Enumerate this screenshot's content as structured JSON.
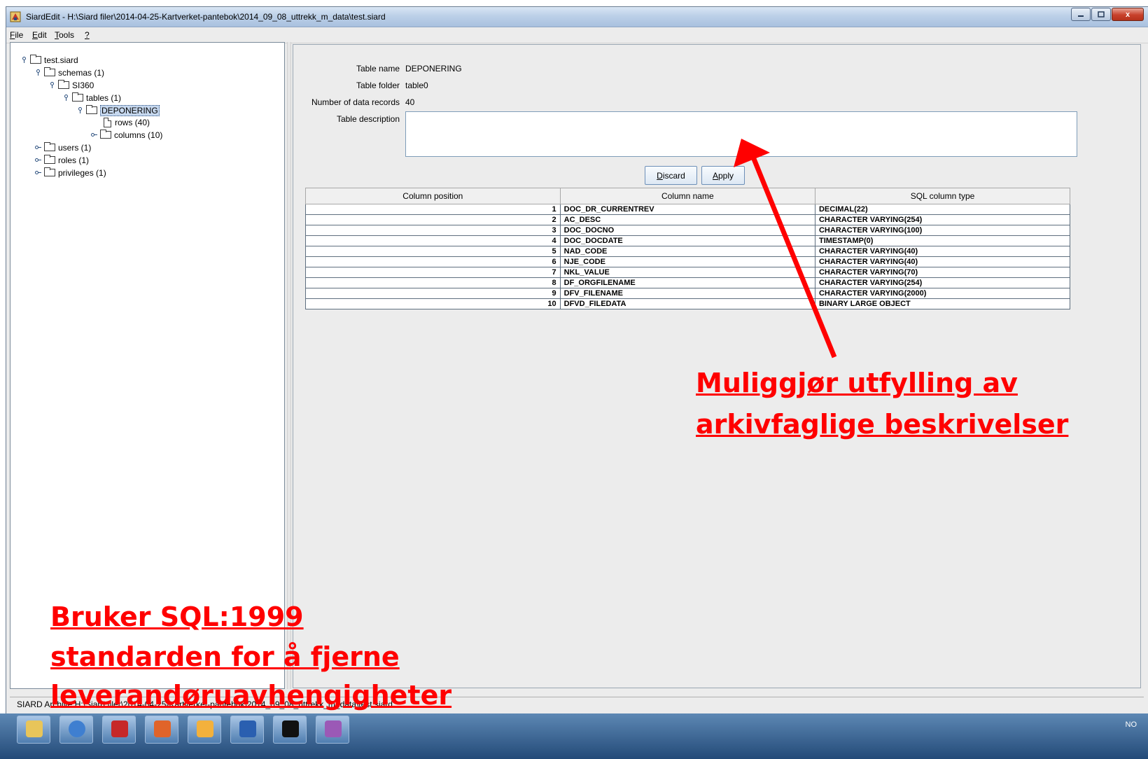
{
  "window": {
    "title": "SiardEdit - H:\\Siard filer\\2014-04-25-Kartverket-pantebok\\2014_09_08_uttrekk_m_data\\test.siard",
    "controls": {
      "minimize": "–",
      "maximize": "□",
      "close": "x"
    }
  },
  "menu": [
    {
      "label": "File",
      "mnemonic": "F",
      "rest": "ile"
    },
    {
      "label": "Edit",
      "mnemonic": "E",
      "rest": "dit"
    },
    {
      "label": "Tools",
      "mnemonic": "T",
      "rest": "ools"
    },
    {
      "label": "?",
      "mnemonic": "?",
      "rest": ""
    }
  ],
  "tree": [
    {
      "label": "test.siard",
      "icon": "folder-icon",
      "expanded": true
    },
    {
      "label": "schemas (1)",
      "icon": "folder-icon",
      "expanded": true
    },
    {
      "label": "SI360",
      "icon": "folder-icon",
      "expanded": true
    },
    {
      "label": "tables (1)",
      "icon": "folder-icon",
      "expanded": true
    },
    {
      "label": "DEPONERING",
      "icon": "folder-icon",
      "expanded": true,
      "selected": true
    },
    {
      "label": "rows (40)",
      "icon": "file-icon",
      "leaf": true
    },
    {
      "label": "columns (10)",
      "icon": "folder-icon",
      "expanded": false
    },
    {
      "label": "users (1)",
      "icon": "folder-icon",
      "expanded": false
    },
    {
      "label": "roles (1)",
      "icon": "folder-icon",
      "expanded": false
    },
    {
      "label": "privileges (1)",
      "icon": "folder-icon",
      "expanded": false
    }
  ],
  "properties": {
    "table_name_label": "Table name",
    "table_name_value": "DEPONERING",
    "table_folder_label": "Table folder",
    "table_folder_value": "table0",
    "records_label": "Number of data records",
    "records_value": "40",
    "description_label": "Table description",
    "description_value": ""
  },
  "buttons": {
    "discard": {
      "label": "Discard",
      "mnemonic": "D",
      "rest": "iscard"
    },
    "apply": {
      "label": "Apply",
      "mnemonic": "A",
      "rest": "pply"
    }
  },
  "grid": {
    "headers": [
      "Column position",
      "Column name",
      "SQL column type"
    ],
    "rows": [
      [
        "1",
        "DOC_DR_CURRENTREV",
        "DECIMAL(22)"
      ],
      [
        "2",
        "AC_DESC",
        "CHARACTER VARYING(254)"
      ],
      [
        "3",
        "DOC_DOCNO",
        "CHARACTER VARYING(100)"
      ],
      [
        "4",
        "DOC_DOCDATE",
        "TIMESTAMP(0)"
      ],
      [
        "5",
        "NAD_CODE",
        "CHARACTER VARYING(40)"
      ],
      [
        "6",
        "NJE_CODE",
        "CHARACTER VARYING(40)"
      ],
      [
        "7",
        "NKL_VALUE",
        "CHARACTER VARYING(70)"
      ],
      [
        "8",
        "DF_ORGFILENAME",
        "CHARACTER VARYING(254)"
      ],
      [
        "9",
        "DFV_FILENAME",
        "CHARACTER VARYING(2000)"
      ],
      [
        "10",
        "DFVD_FILEDATA",
        "BINARY LARGE OBJECT"
      ]
    ]
  },
  "statusbar": {
    "text": "SIARD Archive H:\\Siard filer\\2014-04-25-Kartverket-pantebok\\2014_09_08_uttrekk_m_data\\test.siard"
  },
  "annotations": {
    "right_line1": "Muliggjør utfylling av",
    "right_line2": "arkivfaglige beskrivelser",
    "left_line1": "Bruker SQL:1999",
    "left_line2": "standarden for å fjerne",
    "left_line3": "leverandøruavhengigheter",
    "color": "#ff0000"
  },
  "taskbar": {
    "apps": [
      "explorer-icon",
      "browser-icon",
      "acrobat-icon",
      "powerpoint-icon",
      "outlook-icon",
      "word-icon",
      "terminal-icon",
      "siardedit-icon"
    ],
    "tray_text": "NO"
  }
}
